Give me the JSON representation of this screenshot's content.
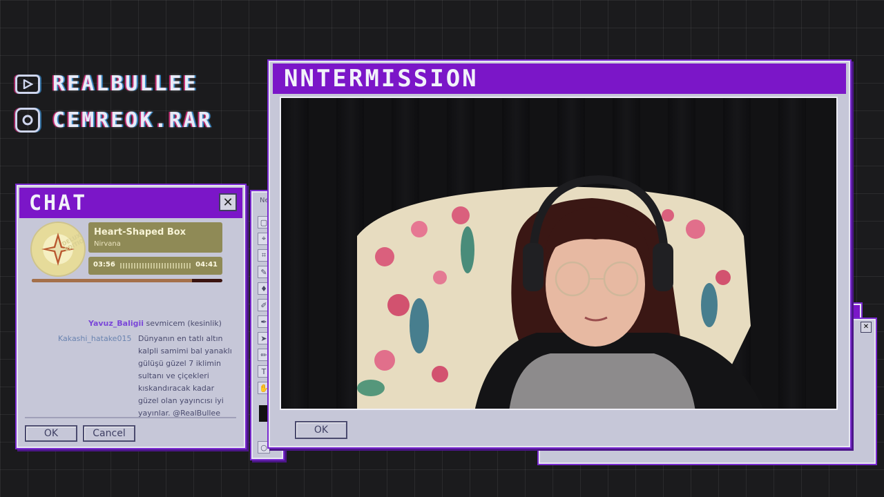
{
  "socials": [
    {
      "icon": "youtube-icon",
      "handle": "REALBULLEE"
    },
    {
      "icon": "instagram-icon",
      "handle": "CEMREOK.RAR"
    }
  ],
  "video_window": {
    "title": "NNTERMISSION",
    "ok_label": "OK"
  },
  "tool_window": {
    "title_fragment": "Ne"
  },
  "chat_window": {
    "title": "CHAT",
    "close_label": "✕",
    "now_playing": {
      "song": "Heart-Shaped Box",
      "artist": "Nirvana",
      "album_art_text": "DELUXE EDITION",
      "elapsed": "03:56",
      "duration": "04:41",
      "progress": 0.84
    },
    "messages": [
      {
        "user": "Yavuz_Baligii",
        "text": "sevmicem (kesinlik)"
      },
      {
        "user": "Kakashi_hatake015",
        "text": "Dünyanın en tatlı altın kalpli samimi bal yanaklı gülüşü güzel 7 iklimin sultanı ve çiçekleri kıskandıracak kadar güzel olan yayıncısı iyi yayınlar. @RealBullee"
      }
    ],
    "ok_label": "OK",
    "cancel_label": "Cancel"
  },
  "colors": {
    "accent": "#7b16c8",
    "window": "#c6c7d8",
    "background": "#1b1b1d"
  }
}
